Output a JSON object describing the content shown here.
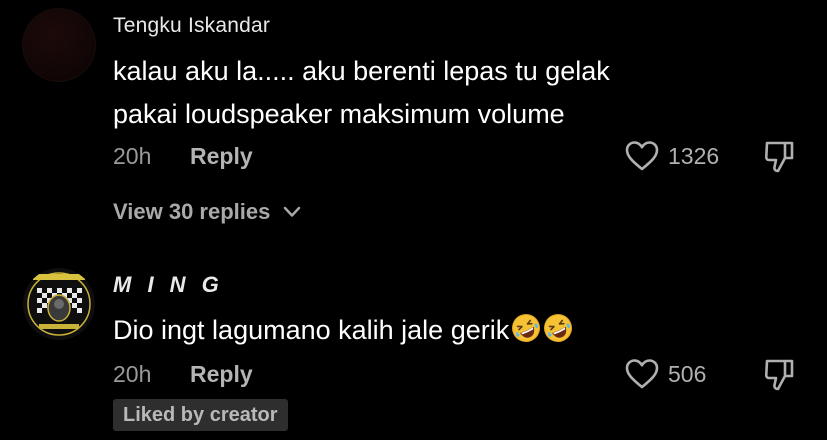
{
  "colors": {
    "background": "#000000",
    "text_primary": "#ffffff",
    "text_secondary": "#9a9a9a",
    "badge_background": "#2e2e2e",
    "emoji_yellow": "#f6c234"
  },
  "comments": [
    {
      "username": "Tengku Iskandar",
      "body_lines": [
        "kalau aku la..... aku berenti lepas tu gelak",
        "pakai loudspeaker maksimum volume"
      ],
      "time": "20h",
      "reply_label": "Reply",
      "like_count": "1326",
      "like_icon": "heart-outline-icon",
      "dislike_icon": "thumbs-down-icon",
      "view_replies_label": "View 30 replies"
    },
    {
      "username": "M I N G",
      "body": "Dio ingt lagumano kalih jale gerik",
      "emojis": [
        "rolling-on-floor-laughing-emoji",
        "rolling-on-floor-laughing-emoji"
      ],
      "time": "20h",
      "reply_label": "Reply",
      "like_count": "506",
      "like_icon": "heart-outline-icon",
      "dislike_icon": "thumbs-down-icon",
      "badge": "Liked by creator"
    }
  ]
}
